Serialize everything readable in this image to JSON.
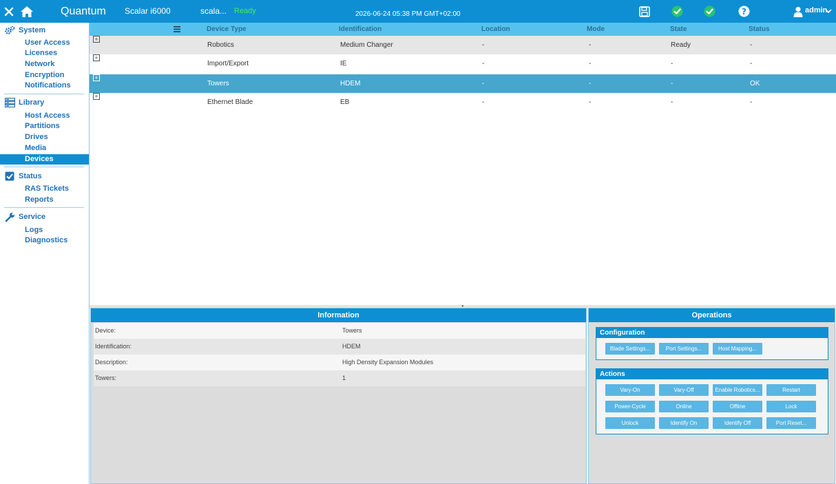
{
  "header": {
    "brand": "Quantum",
    "product": "Scalar i6000",
    "hostname": "scala...",
    "library_state": "Ready",
    "datetime": "2026-06-24 05:38 PM GMT+02:00",
    "user": "admin",
    "icons": [
      "close-icon",
      "home-icon",
      "save-icon",
      "check-icon",
      "check-icon",
      "help-icon",
      "user-icon",
      "chevron-down-icon"
    ],
    "colors": {
      "bar": "#0e8fd3",
      "ready": "#44ee55",
      "check": "#2cc36b"
    }
  },
  "sidebar": {
    "sections": [
      {
        "title": "System",
        "icon": "gears-icon",
        "items": [
          "User Access",
          "Licenses",
          "Network",
          "Encryption",
          "Notifications"
        ]
      },
      {
        "title": "Library",
        "icon": "library-icon",
        "items": [
          "Host Access",
          "Partitions",
          "Drives",
          "Media",
          "Devices"
        ]
      },
      {
        "title": "Status",
        "icon": "checkbox-icon",
        "items": [
          "RAS Tickets",
          "Reports"
        ]
      },
      {
        "title": "Service",
        "icon": "wrench-icon",
        "items": [
          "Logs",
          "Diagnostics"
        ]
      }
    ],
    "active_item": "Devices"
  },
  "table": {
    "columns": [
      "Device Type",
      "Identification",
      "Location",
      "Mode",
      "State",
      "Status"
    ],
    "menu_icon": "menu-icon",
    "rows": [
      {
        "type": "Robotics",
        "id": "Medium Changer",
        "location": "-",
        "mode": "-",
        "state": "Ready",
        "status": "-"
      },
      {
        "type": "Import/Export",
        "id": "IE",
        "location": "-",
        "mode": "-",
        "state": "-",
        "status": "-"
      },
      {
        "type": "Towers",
        "id": "HDEM",
        "location": "-",
        "mode": "-",
        "state": "-",
        "status": "OK"
      },
      {
        "type": "Ethernet Blade",
        "id": "EB",
        "location": "-",
        "mode": "-",
        "state": "-",
        "status": "-"
      }
    ],
    "selected_row": 2
  },
  "information": {
    "title": "Information",
    "rows": [
      {
        "label": "Device:",
        "value": "Towers"
      },
      {
        "label": "Identification:",
        "value": "HDEM"
      },
      {
        "label": "Description:",
        "value": "High Density Expansion Modules"
      },
      {
        "label": "Towers:",
        "value": "1"
      }
    ]
  },
  "operations": {
    "title": "Operations",
    "configuration": {
      "title": "Configuration",
      "buttons": [
        "Blade Settings...",
        "Port Settings...",
        "Host Mapping..."
      ]
    },
    "actions": {
      "title": "Actions",
      "buttons": [
        "Vary-On",
        "Vary-Off",
        "Enable Robotics...",
        "Restart",
        "Power-Cycle",
        "Online",
        "Offline",
        "Lock",
        "Unlock",
        "Identify On",
        "Identify Off",
        "Port Reset..."
      ]
    }
  }
}
